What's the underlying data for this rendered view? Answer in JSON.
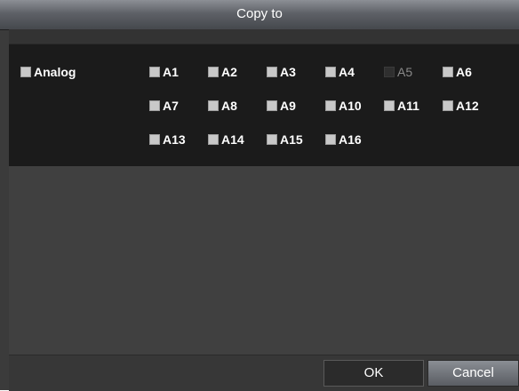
{
  "dialog": {
    "title": "Copy to"
  },
  "analog": {
    "label": "Analog",
    "checked": false
  },
  "channels": [
    {
      "label": "A1",
      "disabled": false
    },
    {
      "label": "A2",
      "disabled": false
    },
    {
      "label": "A3",
      "disabled": false
    },
    {
      "label": "A4",
      "disabled": false
    },
    {
      "label": "A5",
      "disabled": true
    },
    {
      "label": "A6",
      "disabled": false
    },
    {
      "label": "A7",
      "disabled": false
    },
    {
      "label": "A8",
      "disabled": false
    },
    {
      "label": "A9",
      "disabled": false
    },
    {
      "label": "A10",
      "disabled": false
    },
    {
      "label": "A11",
      "disabled": false
    },
    {
      "label": "A12",
      "disabled": false
    },
    {
      "label": "A13",
      "disabled": false
    },
    {
      "label": "A14",
      "disabled": false
    },
    {
      "label": "A15",
      "disabled": false
    },
    {
      "label": "A16",
      "disabled": false
    }
  ],
  "buttons": {
    "ok": "OK",
    "cancel": "Cancel"
  }
}
